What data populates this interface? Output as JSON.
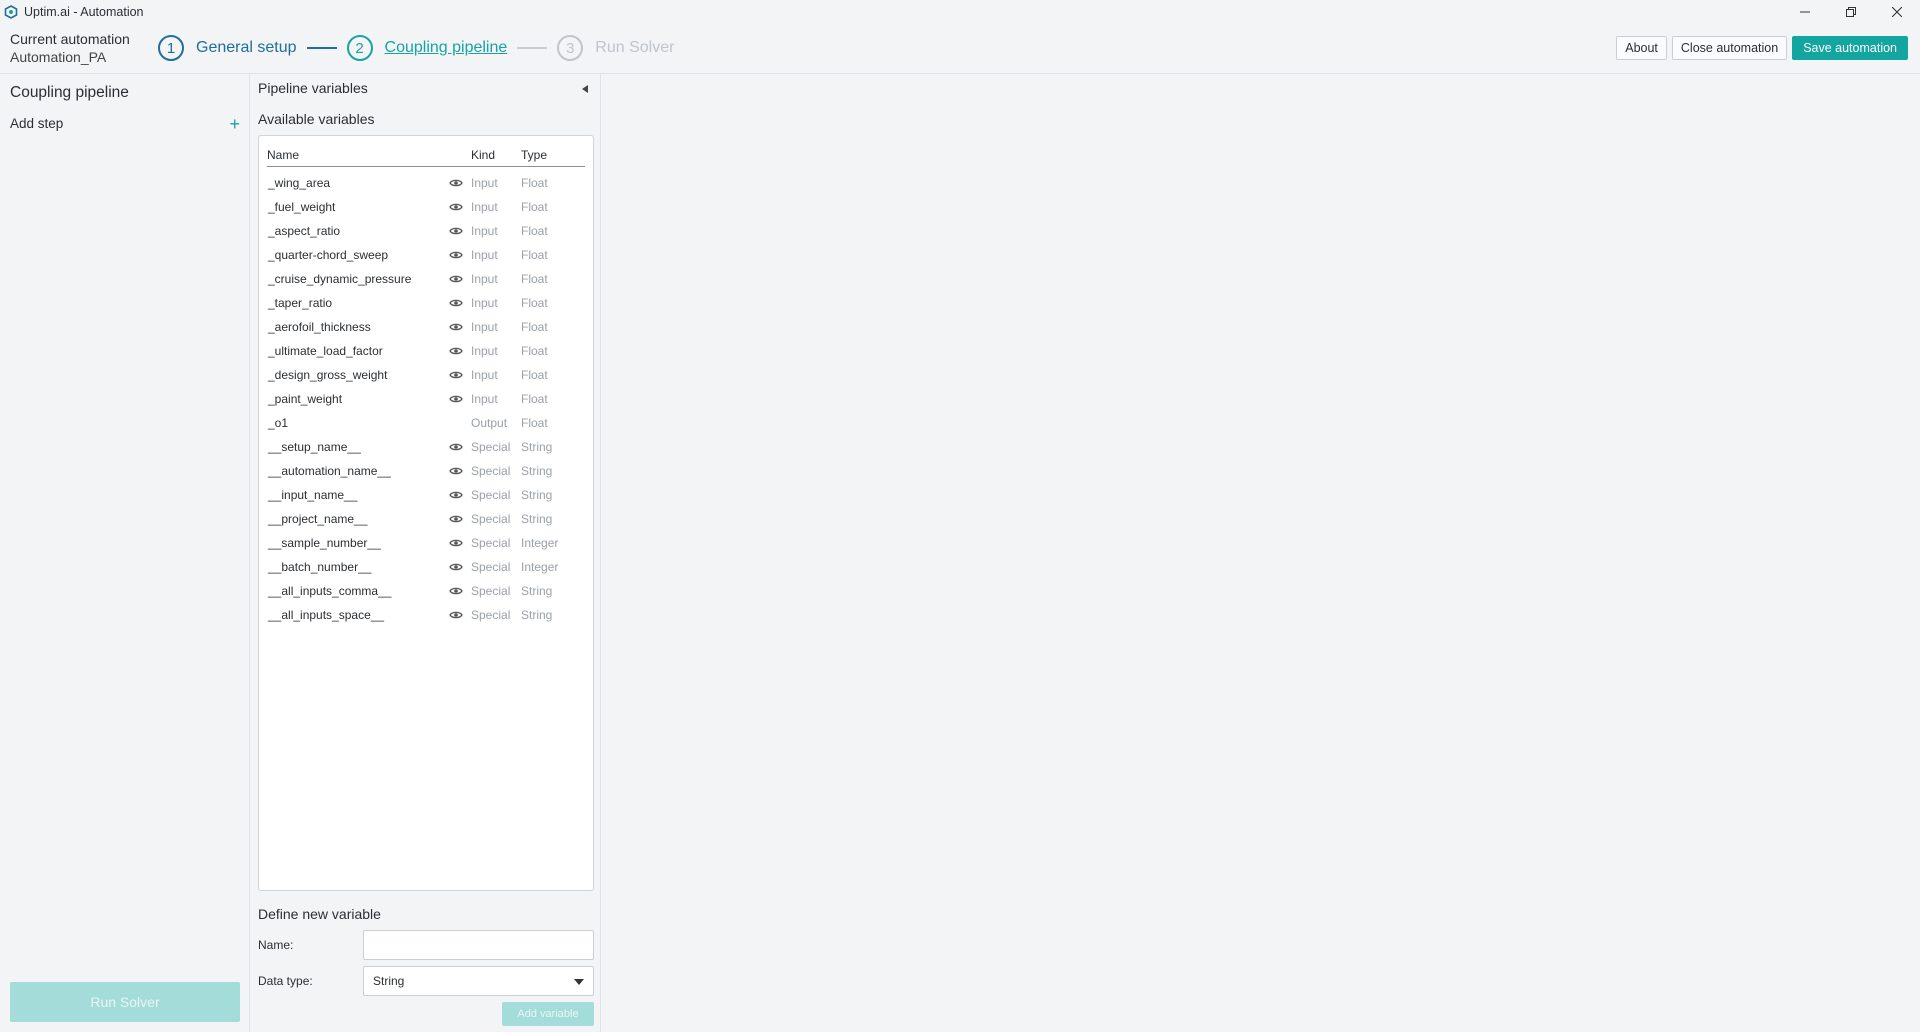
{
  "window": {
    "title": "Uptim.ai - Automation"
  },
  "header": {
    "current_label": "Current automation",
    "current_name": "Automation_PA",
    "steps": [
      {
        "number": "1",
        "label": "General setup"
      },
      {
        "number": "2",
        "label": "Coupling pipeline"
      },
      {
        "number": "3",
        "label": "Run Solver"
      }
    ],
    "buttons": {
      "about": "About",
      "close": "Close automation",
      "save": "Save automation"
    },
    "accent_color": "#13a6a0"
  },
  "sidebar": {
    "title": "Coupling pipeline",
    "add_step": "Add step",
    "run_solver": "Run Solver"
  },
  "pipeline": {
    "title": "Pipeline variables",
    "available_title": "Available variables",
    "columns": {
      "name": "Name",
      "kind": "Kind",
      "type": "Type"
    },
    "variables": [
      {
        "name": "_wing_area",
        "kind": "Input",
        "type": "Float",
        "visible_icon": true
      },
      {
        "name": "_fuel_weight",
        "kind": "Input",
        "type": "Float",
        "visible_icon": true
      },
      {
        "name": "_aspect_ratio",
        "kind": "Input",
        "type": "Float",
        "visible_icon": true
      },
      {
        "name": "_quarter-chord_sweep",
        "kind": "Input",
        "type": "Float",
        "visible_icon": true
      },
      {
        "name": "_cruise_dynamic_pressure",
        "kind": "Input",
        "type": "Float",
        "visible_icon": true
      },
      {
        "name": "_taper_ratio",
        "kind": "Input",
        "type": "Float",
        "visible_icon": true
      },
      {
        "name": "_aerofoil_thickness",
        "kind": "Input",
        "type": "Float",
        "visible_icon": true
      },
      {
        "name": "_ultimate_load_factor",
        "kind": "Input",
        "type": "Float",
        "visible_icon": true
      },
      {
        "name": "_design_gross_weight",
        "kind": "Input",
        "type": "Float",
        "visible_icon": true
      },
      {
        "name": "_paint_weight",
        "kind": "Input",
        "type": "Float",
        "visible_icon": true
      },
      {
        "name": "_o1",
        "kind": "Output",
        "type": "Float",
        "visible_icon": false
      },
      {
        "name": "__setup_name__",
        "kind": "Special",
        "type": "String",
        "visible_icon": true
      },
      {
        "name": "__automation_name__",
        "kind": "Special",
        "type": "String",
        "visible_icon": true
      },
      {
        "name": "__input_name__",
        "kind": "Special",
        "type": "String",
        "visible_icon": true
      },
      {
        "name": "__project_name__",
        "kind": "Special",
        "type": "String",
        "visible_icon": true
      },
      {
        "name": "__sample_number__",
        "kind": "Special",
        "type": "Integer",
        "visible_icon": true
      },
      {
        "name": "__batch_number__",
        "kind": "Special",
        "type": "Integer",
        "visible_icon": true
      },
      {
        "name": "__all_inputs_comma__",
        "kind": "Special",
        "type": "String",
        "visible_icon": true
      },
      {
        "name": "__all_inputs_space__",
        "kind": "Special",
        "type": "String",
        "visible_icon": true
      }
    ],
    "define": {
      "title": "Define new variable",
      "name_label": "Name:",
      "name_value": "",
      "type_label": "Data type:",
      "type_value": "String",
      "add_button": "Add variable"
    }
  }
}
